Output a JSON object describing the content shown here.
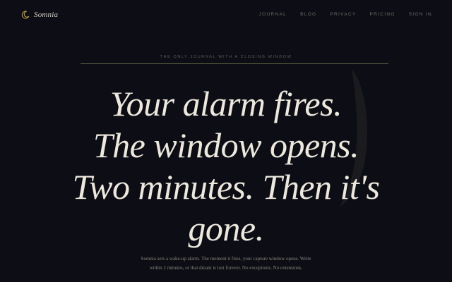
{
  "brand": {
    "name": "Somnia",
    "icon": "crescent-moon-icon",
    "accent": "#c9a64a"
  },
  "nav": {
    "items": [
      {
        "label": "JOURNAL"
      },
      {
        "label": "BLOG"
      },
      {
        "label": "PRIVACY"
      },
      {
        "label": "PRICING"
      },
      {
        "label": "SIGN IN"
      }
    ]
  },
  "hero": {
    "eyebrow": "THE ONLY JOURNAL WITH A CLOSING WINDOW",
    "headline_lines": [
      "Your alarm fires.",
      "The window opens.",
      "Two minutes. Then it's",
      "gone."
    ],
    "subtext": "Somnia sets a wake-up alarm. The moment it fires, your capture window opens. Write within 2 minutes, or that dream is lost forever. No exceptions. No extensions."
  },
  "colors": {
    "background": "#0c0d15",
    "headline": "#ede8dc",
    "rule": "#6b6a4a"
  }
}
